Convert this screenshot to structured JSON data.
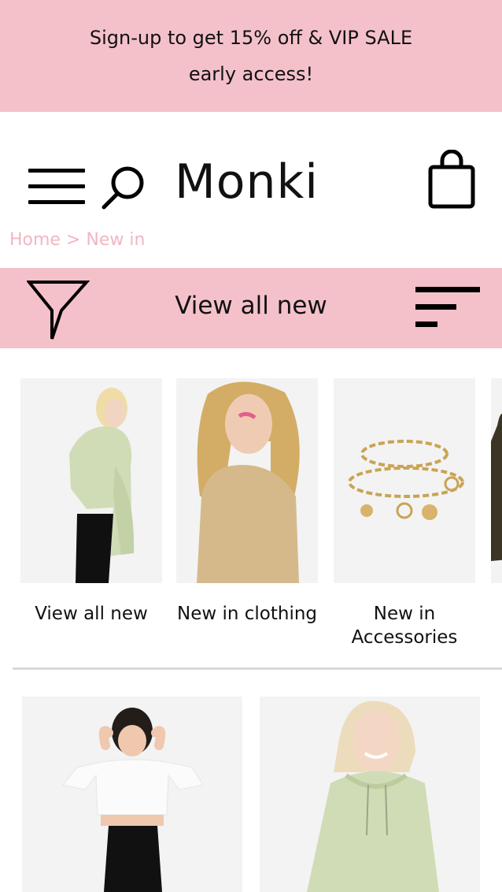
{
  "promo": {
    "text": "Sign-up to get 15% off & VIP SALE early access!"
  },
  "header": {
    "logo": "Monki",
    "icons": [
      "menu-icon",
      "search-icon",
      "shopping-bag-icon"
    ]
  },
  "breadcrumb": {
    "home": "Home",
    "separator": ">",
    "current": "New in"
  },
  "filterbar": {
    "title": "View all new",
    "icons": [
      "filter-icon",
      "sort-icon"
    ]
  },
  "categories": [
    {
      "label": "View all new"
    },
    {
      "label": "New in clothing"
    },
    {
      "label": "New in Accessories"
    }
  ],
  "colors": {
    "accent_pink": "#f4c1cb",
    "breadcrumb_pink": "#f1b6c2",
    "image_background": "#f3f3f3"
  }
}
